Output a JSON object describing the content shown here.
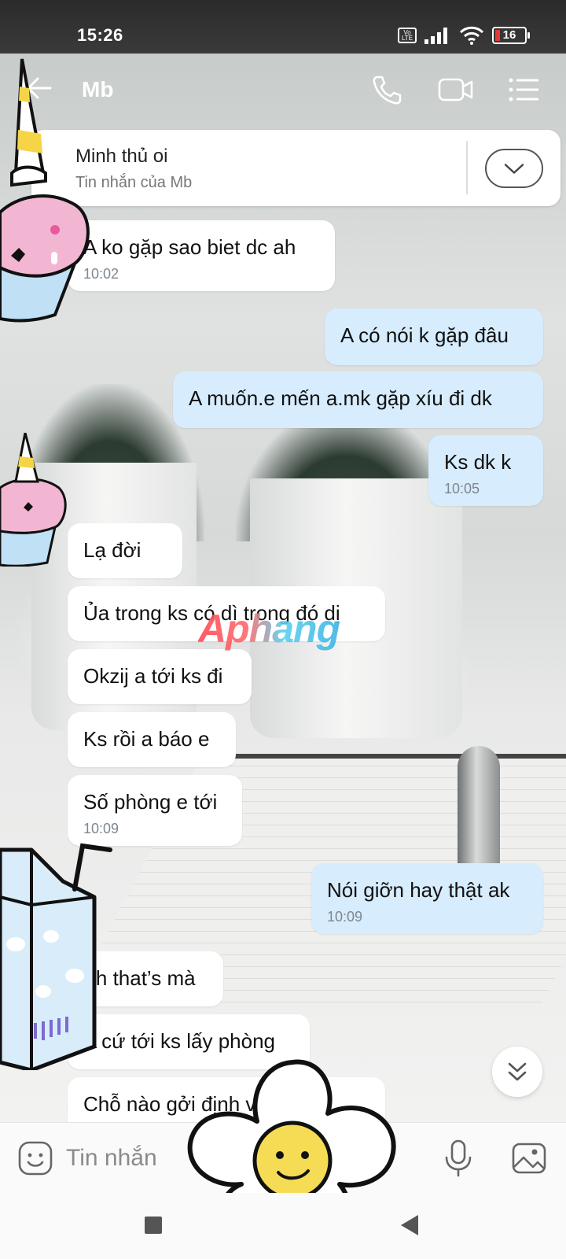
{
  "status_bar": {
    "time": "15:26",
    "volte_label": "Vo LTE",
    "battery_level": "16"
  },
  "header": {
    "contact_name": "Mb"
  },
  "pinned": {
    "title": "Minh thủ oi",
    "subtitle": "Tin nhắn của Mb"
  },
  "messages": [
    {
      "side": "in",
      "text": "A ko gặp sao biet dc ah",
      "time": "10:02"
    },
    {
      "side": "out",
      "text": "A có nói k gặp đâu",
      "time": ""
    },
    {
      "side": "out",
      "text": "A muốn.e mến a.mk gặp xíu đi dk",
      "time": ""
    },
    {
      "side": "out",
      "text": "Ks dk k",
      "time": "10:05"
    },
    {
      "side": "in",
      "text": "Lạ đời",
      "time": ""
    },
    {
      "side": "in",
      "text": "Ủa trong ks có dì trong đó dị",
      "time": ""
    },
    {
      "side": "in",
      "text": "Okzij a tới ks đi",
      "time": ""
    },
    {
      "side": "in",
      "text": "Ks rồi a báo e",
      "time": ""
    },
    {
      "side": "in",
      "text": "Số phòng e tới",
      "time": "10:09"
    },
    {
      "side": "out",
      "text": "Nói giỡn hay thật ak",
      "time": "10:09"
    },
    {
      "side": "in",
      "text": "Th that’s mà",
      "time": ""
    },
    {
      "side": "in",
      "text": "A cứ tới ks lấy phòng",
      "time": ""
    },
    {
      "side": "in",
      "text": "Chỗ nào gởi định vị e tới",
      "time": ""
    }
  ],
  "watermark": "Aphang",
  "input": {
    "placeholder": "Tin nhắn"
  },
  "icons": {
    "back": "arrow-left-icon",
    "call": "phone-icon",
    "video": "video-camera-icon",
    "menu": "list-menu-icon",
    "expand": "chevron-down-icon",
    "scroll": "double-chevron-down-icon",
    "emoji": "sticker-smiley-icon",
    "mic": "microphone-icon",
    "image": "image-icon"
  },
  "colors": {
    "incoming_bubble": "#ffffff",
    "outgoing_bubble": "#d7ecfc",
    "time_text": "#7d8790"
  }
}
